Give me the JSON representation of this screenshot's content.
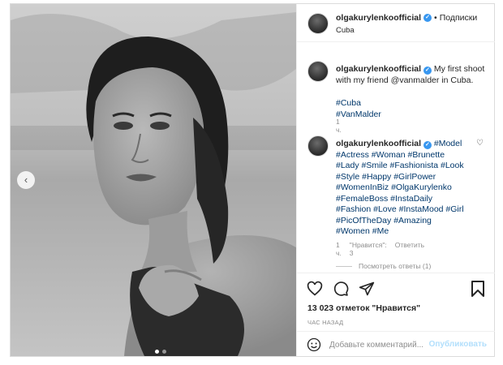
{
  "post": {
    "username": "olgakurylenkoofficial",
    "separator": "•",
    "follow_label": "Подписки",
    "location": "Cuba",
    "verified_icon": "✓"
  },
  "carousel": {
    "prev_icon": "chevron-left-icon",
    "prev_glyph": "‹",
    "dots": 2,
    "active_dot": 0
  },
  "comments": [
    {
      "username": "olgakurylenkoofficial",
      "text_lines": [
        "My first shoot",
        "with my friend @vanmalder in Cuba."
      ],
      "hashtags": "#Cuba #VanMalder",
      "age": "1 ч."
    },
    {
      "username": "olgakurylenkoofficial",
      "first_tag": "#Model",
      "tag_lines": [
        "#Actress #Woman #Brunette",
        "#Lady #Smile #Fashionista #Look",
        "#Style #Happy #GirlPower",
        "#WomenInBiz #OlgaKurylenko",
        "#FemaleBoss #InstaDaily",
        "#Fashion #Love #InstaMood #Girl",
        "#PicOfTheDay #Amazing",
        "#Women #Me"
      ],
      "age": "1 ч.",
      "likes": "\"Нравится\": 3",
      "reply": "Ответить",
      "like_glyph": "♡"
    }
  ],
  "replies_label": "Посмотреть ответы (1)",
  "likes_count": "13 023 отметок \"Нравится\"",
  "timestamp": "ЧАС НАЗАД",
  "comment_box": {
    "placeholder": "Добавьте комментарий...",
    "publish_label": "Опубликовать"
  },
  "colors": {
    "link": "#00376b",
    "verified": "#3897f0",
    "publish_disabled": "#b2dffc",
    "muted": "#8e8e8e"
  }
}
